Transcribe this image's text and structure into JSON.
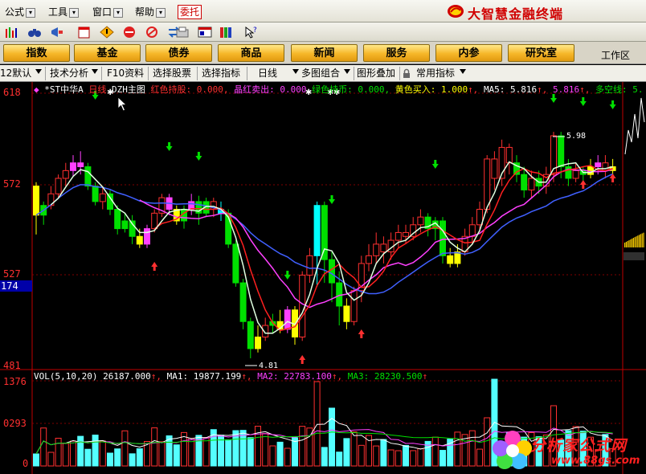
{
  "menu": {
    "items": [
      "公式",
      "工具",
      "窗口",
      "帮助"
    ],
    "weituo": "委托",
    "brand": "大智慧金融终端"
  },
  "toolbar": {
    "icons": [
      "bar-chart-icon",
      "binoculars-icon",
      "megaphone-icon",
      "notepad-icon",
      "warning-diamond-icon",
      "no-entry-icon",
      "prohibit-icon",
      "swap-icon",
      "tray-icon",
      "window-icon",
      "book-icon",
      "help-pointer-icon"
    ]
  },
  "nav": {
    "buttons": [
      "指数",
      "基金",
      "债券",
      "商品",
      "新闻",
      "服务",
      "内参",
      "研究室"
    ],
    "work": "工作区"
  },
  "tabs": {
    "default_label": "12默认",
    "tech": "技术分析",
    "f10": "F10资料",
    "select_stock": "选择股票",
    "select_indicator": "选择指标",
    "period": "日线",
    "multi": "多图组合",
    "overlay": "图形叠加",
    "common": "常用指标"
  },
  "chart_header": {
    "symbol": "*ST中华A",
    "period": "日线",
    "main": "DZH主图",
    "items": [
      {
        "label": "红色持股: 0.000,",
        "color": "#ff3030"
      },
      {
        "label": "晶红卖出: 0.000",
        "color": "#ff40ff"
      },
      {
        "label": "绿色持币: 0.000,",
        "color": "#00e000"
      },
      {
        "label": "黄色买入: 1.000",
        "color": "#ffff00"
      },
      {
        "label": "MA5: 5.816",
        "color": "#ffffff"
      },
      {
        "label": "5.816",
        "color": "#ff40ff"
      },
      {
        "label": "多空线: 5.",
        "color": "#00e000"
      }
    ]
  },
  "price_axis": {
    "labels": [
      "618",
      "572",
      "527",
      "481"
    ],
    "current": "174"
  },
  "annotations": {
    "high": "5.98",
    "low": "4.81"
  },
  "vol_header": {
    "title": "VOL(5,10,20)",
    "vol": "26187.000",
    "ma1": "MA1: 19877.199",
    "ma2": "MA2: 22783.100",
    "ma3": "MA3: 28230.500"
  },
  "vol_axis": {
    "labels": [
      "1376",
      "0293",
      "0"
    ]
  },
  "watermark": {
    "text": "分析家公式网",
    "url": "www.88gs.com"
  },
  "chart_data": {
    "type": "candlestick",
    "price_ylim": [
      4.81,
      6.18
    ],
    "colors": {
      "up": "#ff3030",
      "down": "#00ffff",
      "green": "#00e000",
      "yellow": "#ffff00",
      "magenta": "#ff40ff"
    },
    "candles": [
      [
        5.7,
        5.55,
        5.72,
        5.45,
        "y"
      ],
      [
        5.55,
        5.6,
        5.62,
        5.5,
        "g"
      ],
      [
        5.6,
        5.66,
        5.7,
        5.58,
        "u"
      ],
      [
        5.66,
        5.74,
        5.76,
        5.64,
        "u"
      ],
      [
        5.74,
        5.78,
        5.82,
        5.7,
        "u"
      ],
      [
        5.78,
        5.82,
        5.86,
        5.75,
        "m"
      ],
      [
        5.82,
        5.8,
        5.88,
        5.76,
        "m"
      ],
      [
        5.8,
        5.7,
        5.82,
        5.68,
        "g"
      ],
      [
        5.7,
        5.62,
        5.72,
        5.6,
        "g"
      ],
      [
        5.62,
        5.66,
        5.7,
        5.58,
        "u"
      ],
      [
        5.66,
        5.58,
        5.68,
        5.55,
        "g"
      ],
      [
        5.58,
        5.48,
        5.6,
        5.45,
        "g"
      ],
      [
        5.48,
        5.52,
        5.56,
        5.46,
        "g"
      ],
      [
        5.52,
        5.44,
        5.55,
        5.4,
        "g"
      ],
      [
        5.44,
        5.4,
        5.48,
        5.38,
        "y"
      ],
      [
        5.4,
        5.48,
        5.5,
        5.38,
        "m"
      ],
      [
        5.48,
        5.56,
        5.58,
        5.46,
        "u"
      ],
      [
        5.56,
        5.64,
        5.66,
        5.54,
        "u"
      ],
      [
        5.64,
        5.58,
        5.66,
        5.55,
        "m"
      ],
      [
        5.58,
        5.52,
        5.6,
        5.5,
        "y"
      ],
      [
        5.52,
        5.58,
        5.6,
        5.48,
        "g"
      ],
      [
        5.58,
        5.62,
        5.66,
        5.55,
        "m"
      ],
      [
        5.62,
        5.56,
        5.65,
        5.5,
        "g"
      ],
      [
        5.56,
        5.62,
        5.64,
        5.54,
        "g"
      ],
      [
        5.62,
        5.58,
        5.64,
        5.54,
        "u"
      ],
      [
        5.58,
        5.56,
        5.62,
        5.52,
        "d"
      ],
      [
        5.56,
        5.4,
        5.58,
        5.38,
        "g"
      ],
      [
        5.4,
        5.2,
        5.42,
        5.18,
        "g"
      ],
      [
        5.2,
        5.0,
        5.22,
        4.96,
        "g"
      ],
      [
        5.0,
        4.86,
        5.02,
        4.81,
        "g"
      ],
      [
        4.86,
        4.92,
        4.98,
        4.84,
        "y"
      ],
      [
        4.92,
        4.98,
        5.02,
        4.9,
        "u"
      ],
      [
        4.98,
        5.0,
        5.04,
        4.94,
        "g"
      ],
      [
        5.0,
        4.96,
        5.06,
        4.94,
        "y"
      ],
      [
        4.96,
        5.06,
        5.08,
        4.94,
        "m"
      ],
      [
        5.06,
        4.92,
        5.08,
        4.88,
        "y"
      ],
      [
        4.92,
        5.24,
        5.26,
        4.9,
        "u"
      ],
      [
        5.24,
        5.34,
        5.38,
        5.2,
        "u"
      ],
      [
        5.34,
        5.6,
        5.62,
        5.18,
        "d"
      ],
      [
        5.6,
        5.32,
        5.62,
        5.2,
        "g"
      ],
      [
        5.32,
        5.2,
        5.36,
        5.1,
        "g"
      ],
      [
        5.2,
        5.08,
        5.26,
        4.98,
        "g"
      ],
      [
        5.08,
        5.0,
        5.12,
        4.96,
        "y"
      ],
      [
        5.0,
        5.16,
        5.18,
        4.98,
        "u"
      ],
      [
        5.16,
        5.3,
        5.34,
        5.1,
        "u"
      ],
      [
        5.3,
        5.34,
        5.4,
        5.26,
        "u"
      ],
      [
        5.34,
        5.4,
        5.46,
        5.3,
        "u"
      ],
      [
        5.4,
        5.36,
        5.44,
        5.3,
        "u"
      ],
      [
        5.36,
        5.42,
        5.46,
        5.32,
        "u"
      ],
      [
        5.42,
        5.46,
        5.5,
        5.38,
        "u"
      ],
      [
        5.46,
        5.44,
        5.5,
        5.4,
        "u"
      ],
      [
        5.44,
        5.5,
        5.54,
        5.42,
        "u"
      ],
      [
        5.5,
        5.54,
        5.58,
        5.46,
        "u"
      ],
      [
        5.54,
        5.48,
        5.56,
        5.44,
        "g"
      ],
      [
        5.48,
        5.52,
        5.54,
        5.42,
        "g"
      ],
      [
        5.52,
        5.34,
        5.54,
        5.3,
        "g"
      ],
      [
        5.34,
        5.3,
        5.38,
        5.28,
        "y"
      ],
      [
        5.3,
        5.36,
        5.4,
        5.28,
        "y"
      ],
      [
        5.36,
        5.44,
        5.48,
        5.34,
        "u"
      ],
      [
        5.44,
        5.5,
        5.54,
        5.4,
        "u"
      ],
      [
        5.5,
        5.58,
        5.62,
        5.46,
        "u"
      ],
      [
        5.58,
        5.84,
        5.86,
        5.56,
        "u"
      ],
      [
        5.84,
        5.74,
        5.88,
        5.68,
        "u"
      ],
      [
        5.74,
        5.9,
        5.94,
        5.7,
        "u"
      ],
      [
        5.9,
        5.82,
        5.92,
        5.76,
        "u"
      ],
      [
        5.82,
        5.76,
        5.86,
        5.72,
        "g"
      ],
      [
        5.76,
        5.68,
        5.8,
        5.64,
        "g"
      ],
      [
        5.68,
        5.74,
        5.78,
        5.64,
        "u"
      ],
      [
        5.74,
        5.7,
        5.78,
        5.66,
        "g"
      ],
      [
        5.7,
        5.76,
        5.8,
        5.66,
        "u"
      ],
      [
        5.76,
        5.96,
        5.98,
        5.72,
        "u"
      ],
      [
        5.96,
        5.8,
        5.98,
        5.74,
        "g"
      ],
      [
        5.8,
        5.74,
        5.84,
        5.7,
        "g"
      ],
      [
        5.74,
        5.78,
        5.82,
        5.72,
        "u"
      ],
      [
        5.78,
        5.76,
        5.8,
        5.72,
        "g"
      ],
      [
        5.76,
        5.8,
        5.84,
        5.74,
        "y"
      ],
      [
        5.8,
        5.82,
        5.86,
        5.76,
        "m"
      ],
      [
        5.82,
        5.78,
        5.86,
        5.74,
        "u"
      ],
      [
        5.78,
        5.8,
        5.84,
        5.74,
        "y"
      ]
    ]
  }
}
